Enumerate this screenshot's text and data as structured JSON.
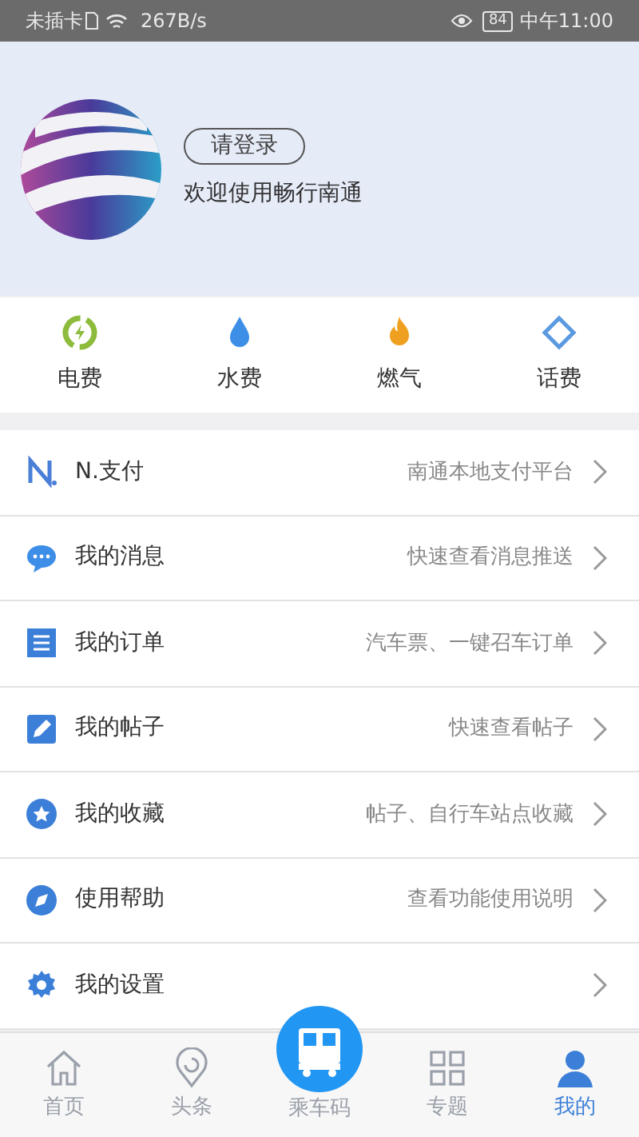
{
  "status_bar": {
    "carrier": "未插卡",
    "speed": "267B/s",
    "battery": "84",
    "time": "中午11:00"
  },
  "profile": {
    "login_button": "请登录",
    "welcome": "欢迎使用畅行南通"
  },
  "utilities": [
    {
      "label": "电费"
    },
    {
      "label": "水费"
    },
    {
      "label": "燃气"
    },
    {
      "label": "话费"
    }
  ],
  "menu": [
    {
      "label": "N.支付",
      "hint": "南通本地支付平台"
    },
    {
      "label": "我的消息",
      "hint": "快速查看消息推送"
    },
    {
      "label": "我的订单",
      "hint": "汽车票、一键召车订单"
    },
    {
      "label": "我的帖子",
      "hint": "快速查看帖子"
    },
    {
      "label": "我的收藏",
      "hint": "帖子、自行车站点收藏"
    },
    {
      "label": "使用帮助",
      "hint": "查看功能使用说明"
    },
    {
      "label": "我的设置"
    }
  ],
  "bottom_nav": [
    {
      "label": "首页",
      "selected": false
    },
    {
      "label": "头条",
      "selected": false
    },
    {
      "label": "乘车码",
      "selected": false
    },
    {
      "label": "专题",
      "selected": false
    },
    {
      "label": "我的",
      "selected": true
    }
  ]
}
